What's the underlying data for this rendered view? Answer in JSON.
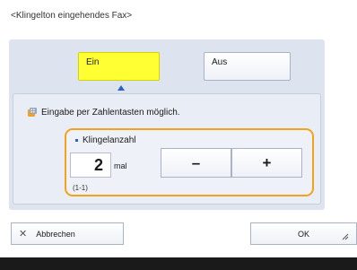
{
  "dialog": {
    "title": "<Klingelton eingehendes Fax>"
  },
  "toggle": {
    "on_label": "Ein",
    "off_label": "Aus",
    "selected": "Ein"
  },
  "info": {
    "message": "Eingabe per Zahlentasten möglich.",
    "icon": "keypad-info-icon"
  },
  "ring_count": {
    "label": "Klingelanzahl",
    "value": "2",
    "unit": "mal",
    "range": "(1-1)",
    "decrement_label": "–",
    "increment_label": "+"
  },
  "actions": {
    "cancel_label": "Abbrechen",
    "ok_label": "OK"
  },
  "colors": {
    "selected": "#ffff33",
    "focus_border": "#f2a21b",
    "accent": "#2a62c7"
  }
}
